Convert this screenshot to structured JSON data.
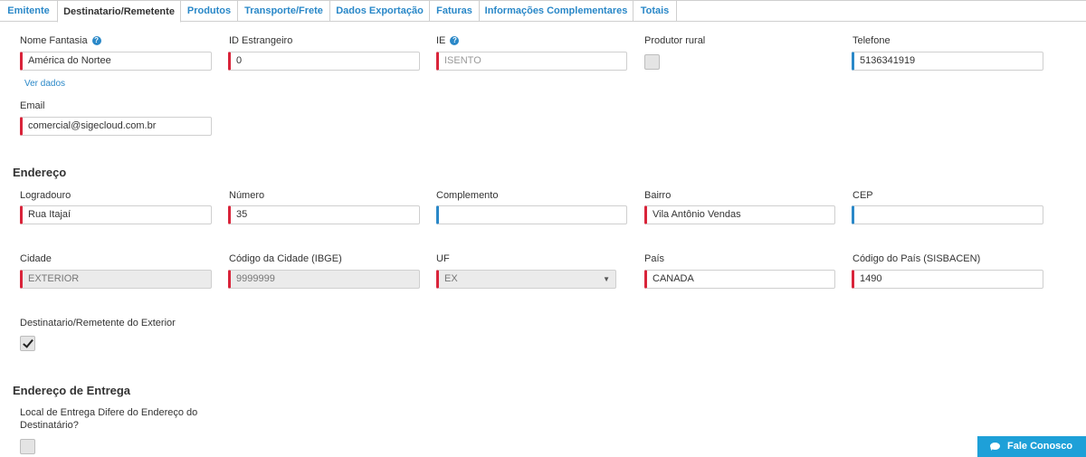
{
  "tabs": [
    {
      "label": "Emitente",
      "active": false
    },
    {
      "label": "Destinatario/Remetente",
      "active": true
    },
    {
      "label": "Produtos",
      "active": false
    },
    {
      "label": "Transporte/Frete",
      "active": false
    },
    {
      "label": "Dados Exportação",
      "active": false
    },
    {
      "label": "Faturas",
      "active": false
    },
    {
      "label": "Informações Complementares",
      "active": false
    },
    {
      "label": "Totais",
      "active": false
    }
  ],
  "dest": {
    "nome_fantasia": {
      "label": "Nome Fantasia",
      "value": "América do Nortee",
      "help_icon": "question-icon"
    },
    "id_estrangeiro": {
      "label": "ID Estrangeiro",
      "value": "0"
    },
    "ie": {
      "label": "IE",
      "placeholder": "ISENTO",
      "help_icon": "question-icon"
    },
    "produtor_rural": {
      "label": "Produtor rural",
      "checked": false
    },
    "telefone": {
      "label": "Telefone",
      "value": "5136341919"
    },
    "ver_dados": "Ver dados",
    "email": {
      "label": "Email",
      "value": "comercial@sigecloud.com.br"
    }
  },
  "endereco": {
    "title": "Endereço",
    "logradouro": {
      "label": "Logradouro",
      "value": "Rua Itajaí"
    },
    "numero": {
      "label": "Número",
      "value": "35"
    },
    "complemento": {
      "label": "Complemento",
      "value": ""
    },
    "bairro": {
      "label": "Bairro",
      "value": "Vila Antônio Vendas"
    },
    "cep": {
      "label": "CEP",
      "value": ""
    },
    "cidade": {
      "label": "Cidade",
      "value": "EXTERIOR"
    },
    "codigo_cidade": {
      "label": "Código da Cidade (IBGE)",
      "value": "9999999"
    },
    "uf": {
      "label": "UF",
      "value": "EX"
    },
    "pais": {
      "label": "País",
      "value": "CANADA"
    },
    "codigo_pais": {
      "label": "Código do País (SISBACEN)",
      "value": "1490"
    },
    "exterior": {
      "label": "Destinatario/Remetente do Exterior",
      "checked": true
    }
  },
  "entrega": {
    "title": "Endereço de Entrega",
    "difere": {
      "label": "Local de Entrega Difere do Endereço do Destinatário?",
      "checked": false
    }
  },
  "fale_conosco": "Fale Conosco",
  "colors": {
    "required": "#d9243a",
    "optional": "#2a88c8",
    "link": "#2a88c8",
    "chat_button": "#1ea0d8"
  }
}
